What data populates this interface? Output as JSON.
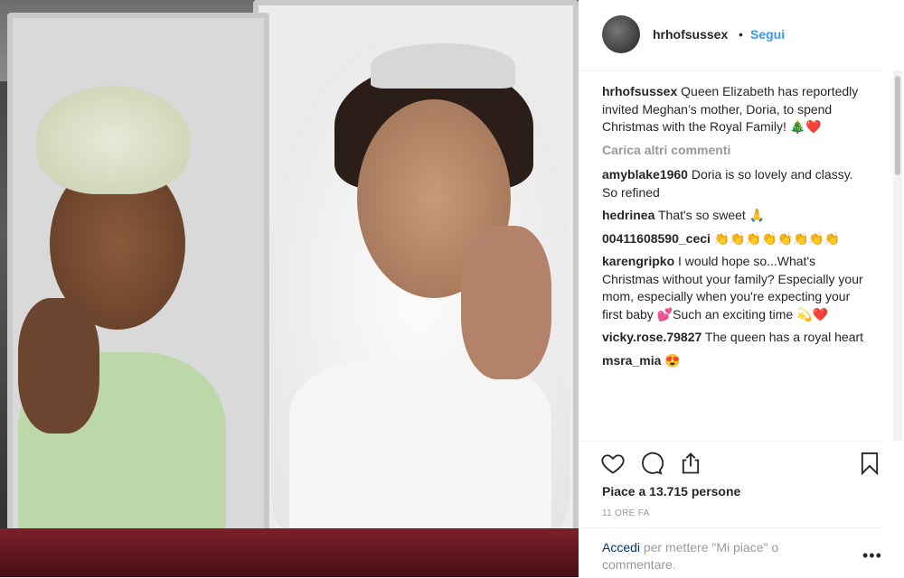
{
  "post": {
    "username": "hrhofsussex",
    "follow_label": "Segui",
    "separator": "•",
    "caption": "Queen Elizabeth has reportedly invited Meghan’s mother, Doria, to spend Christmas with the Royal Family! 🎄❤️",
    "load_more": "Carica altri commenti",
    "comments": [
      {
        "user": "amyblake1960",
        "text": "Doria is so lovely and classy. So refined"
      },
      {
        "user": "hedrinea",
        "text": "That's so sweet 🙏"
      },
      {
        "user": "00411608590_ceci",
        "text": "👏👏👏👏👏👏👏👏"
      },
      {
        "user": "karengripko",
        "text": "I would hope so...What's Christmas without your family? Especially your mom, especially when you're expecting your first baby 💕Such an exciting time 💫❤️"
      },
      {
        "user": "vicky.rose.79827",
        "text": "The queen has a royal heart"
      },
      {
        "user": "msra_mia",
        "text": "😍"
      }
    ],
    "likes": "Piace a 13.715 persone",
    "time": "11 ORE FA",
    "login_link": "Accedi",
    "login_rest": "per mettere \"Mi piace\" o commentare.",
    "more_label": "•••"
  },
  "icons": {
    "like": "heart-icon",
    "comment": "comment-icon",
    "share": "share-icon",
    "save": "bookmark-icon"
  },
  "colors": {
    "accent": "#3897f0",
    "muted": "#999999",
    "text": "#262626"
  }
}
